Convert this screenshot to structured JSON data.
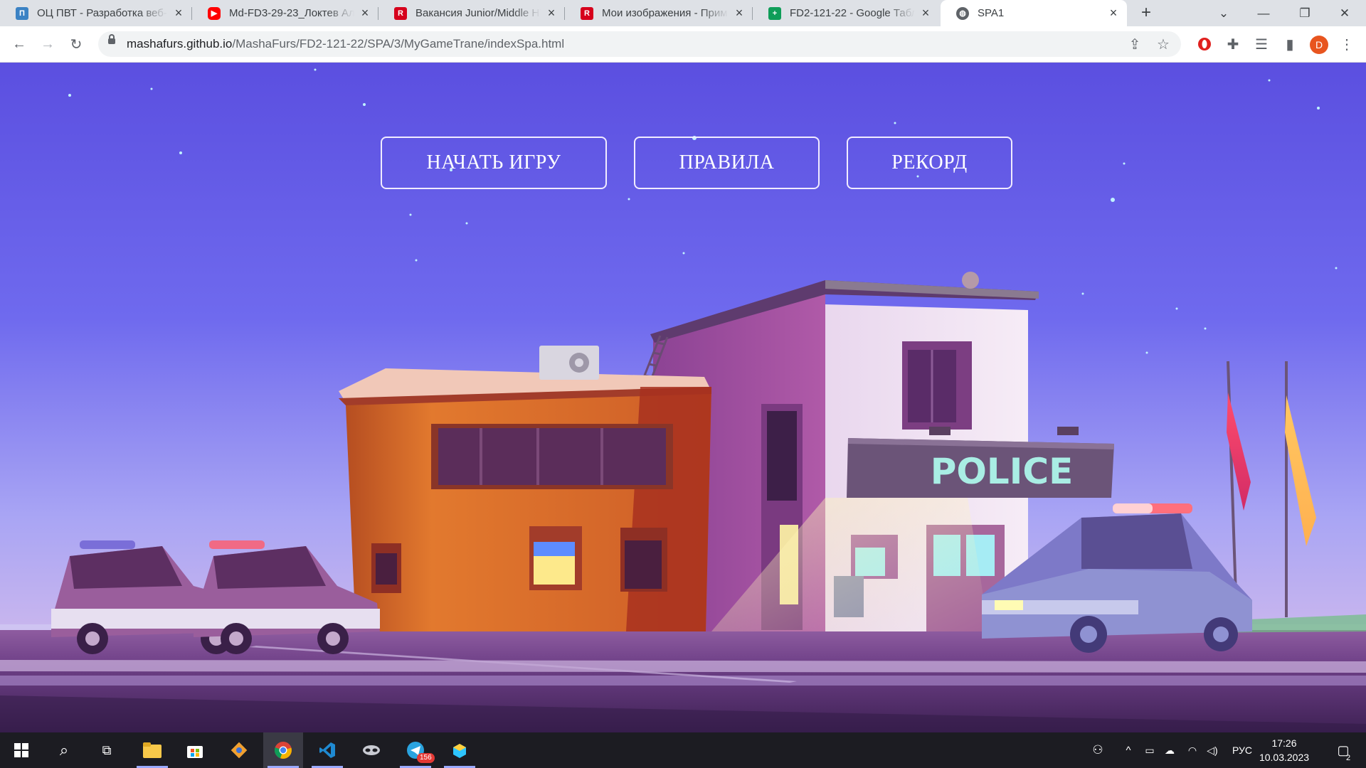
{
  "browser": {
    "tabs": [
      {
        "title": "ОЦ ПВТ - Разработка веб-",
        "favicon": "globe-blue-icon",
        "color": "#3b82c4",
        "active": false
      },
      {
        "title": "Md-FD3-29-23_Локтев Але",
        "favicon": "youtube-icon",
        "color": "#ff0000",
        "active": false
      },
      {
        "title": "Вакансия Junior/Middle HT",
        "favicon": "rabota-r-icon",
        "color": "#d6001c",
        "active": false
      },
      {
        "title": "Мои изображения - Прим",
        "favicon": "rabota-r-icon",
        "color": "#d6001c",
        "active": false
      },
      {
        "title": "FD2-121-22 - Google Табл",
        "favicon": "sheets-icon",
        "color": "#0f9d58",
        "active": false
      },
      {
        "title": "SPA1",
        "favicon": "globe-icon",
        "color": "#5f6368",
        "active": true
      }
    ],
    "url_host": "mashafurs.github.io",
    "url_path": "/MashaFurs/FD2-121-22/SPA/3/MyGameTrane/indexSpa.html",
    "profile_initial": "D",
    "profile_color": "#e8551f"
  },
  "menu": {
    "start": "НАЧАТЬ ИГРУ",
    "rules": "ПРАВИЛА",
    "record": "РЕКОРД"
  },
  "scene": {
    "sign": "POLICE"
  },
  "taskbar": {
    "telegram_badge": "156",
    "language": "РУС",
    "time": "17:26",
    "date": "10.03.2023",
    "notifications": "2"
  }
}
